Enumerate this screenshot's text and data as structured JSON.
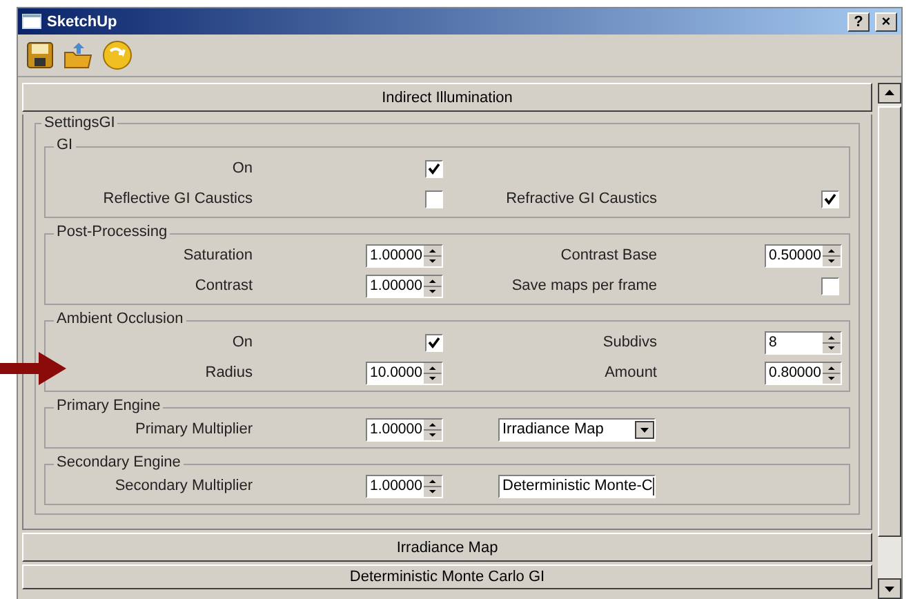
{
  "window": {
    "title": "SketchUp",
    "title_buttons": [
      "?",
      "×"
    ]
  },
  "sections": [
    {
      "title": "Indirect Illumination",
      "settings": {
        "title": "SettingsGI",
        "groups": [
          {
            "title": "GI",
            "rows": [
              [
                {
                  "kind": "label",
                  "text": "On"
                },
                {
                  "kind": "checkbox",
                  "checked": true
                }
              ],
              [
                {
                  "kind": "label",
                  "text": "Reflective GI Caustics"
                },
                {
                  "kind": "checkbox",
                  "checked": false
                },
                {
                  "kind": "label",
                  "text": "Refractive GI Caustics"
                },
                {
                  "kind": "checkbox",
                  "checked": true
                }
              ]
            ]
          },
          {
            "title": "Post-Processing",
            "rows": [
              [
                {
                  "kind": "label",
                  "text": "Saturation"
                },
                {
                  "kind": "spinner",
                  "value": "1.00000"
                },
                {
                  "kind": "label",
                  "text": "Contrast Base"
                },
                {
                  "kind": "spinner",
                  "value": "0.50000"
                }
              ],
              [
                {
                  "kind": "label",
                  "text": "Contrast"
                },
                {
                  "kind": "spinner",
                  "value": "1.00000"
                },
                {
                  "kind": "label",
                  "text": "Save maps per frame"
                },
                {
                  "kind": "checkbox",
                  "checked": false
                }
              ]
            ]
          },
          {
            "title": "Ambient Occlusion",
            "rows": [
              [
                {
                  "kind": "label",
                  "text": "On"
                },
                {
                  "kind": "checkbox",
                  "checked": true
                },
                {
                  "kind": "label",
                  "text": "Subdivs"
                },
                {
                  "kind": "spinner",
                  "value": "8"
                }
              ],
              [
                {
                  "kind": "label",
                  "text": "Radius"
                },
                {
                  "kind": "spinner",
                  "value": "10.0000"
                },
                {
                  "kind": "label",
                  "text": "Amount"
                },
                {
                  "kind": "spinner",
                  "value": "0.80000"
                }
              ]
            ]
          },
          {
            "title": "Primary Engine",
            "rows": [
              [
                {
                  "kind": "label",
                  "text": "Primary Multiplier"
                },
                {
                  "kind": "spinner",
                  "value": "1.00000"
                },
                {
                  "kind": "dropdown",
                  "value": "Irradiance Map"
                }
              ]
            ]
          },
          {
            "title": "Secondary Engine",
            "rows": [
              [
                {
                  "kind": "label",
                  "text": "Secondary Multiplier"
                },
                {
                  "kind": "spinner",
                  "value": "1.00000"
                },
                {
                  "kind": "dropdown",
                  "value": "Deterministic Monte-C"
                }
              ]
            ]
          }
        ]
      }
    },
    {
      "title": "Irradiance Map"
    },
    {
      "title": "Deterministic Monte Carlo GI"
    }
  ]
}
